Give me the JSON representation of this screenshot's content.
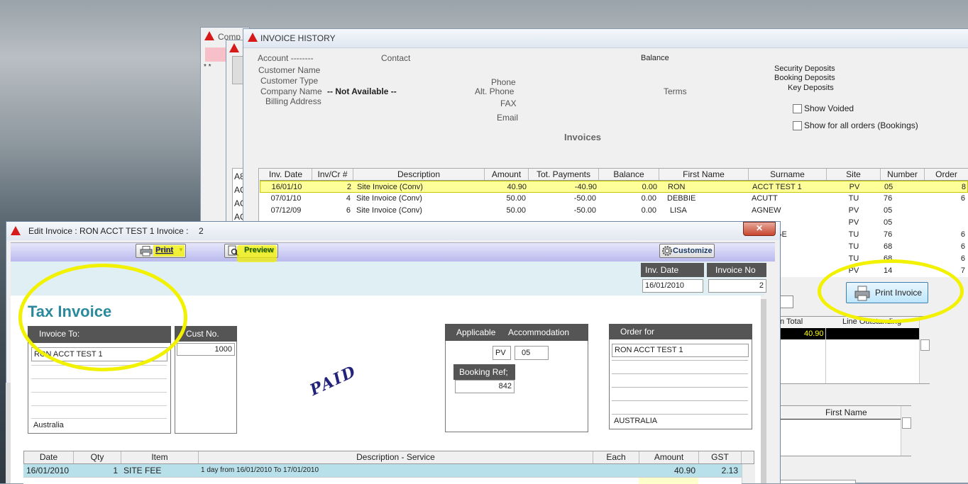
{
  "background_windows": {
    "back1_title": "Comp",
    "stars": "* *",
    "list_items": [
      "A8",
      "AC",
      "AC",
      "AC"
    ]
  },
  "history": {
    "title": "INVOICE HISTORY",
    "account_label": "Account --------",
    "contact_label": "Contact",
    "balance_label": "Balance",
    "customer_name_label": "Customer Name",
    "customer_type_label": "Customer Type",
    "company_name_label": "Company Name",
    "company_name_value": "-- Not Available --",
    "billing_address_label": "Billing Address",
    "phone_label": "Phone",
    "alt_phone_label": "Alt. Phone",
    "fax_label": "FAX",
    "email_label": "Email",
    "terms_label": "Terms",
    "security_deposits": "Security Deposits",
    "booking_deposits": "Booking Deposits",
    "key_deposits": "Key Deposits",
    "show_voided": "Show Voided",
    "show_all_orders": "Show for all orders (Bookings)",
    "invoices_heading": "Invoices",
    "columns": [
      "Inv. Date",
      "Inv/Cr #",
      "Description",
      "Amount",
      "Tot. Payments",
      "Balance",
      "First Name",
      "Surname",
      "Site",
      "Number",
      "Order"
    ],
    "rows": [
      {
        "date": "16/01/10",
        "num": "2",
        "desc": "Site Invoice (Conv)",
        "amount": "40.90",
        "payments": "-40.90",
        "balance": "0.00",
        "first": "RON",
        "surname": "ACCT TEST 1",
        "site": "PV",
        "number": "05",
        "order": "8"
      },
      {
        "date": "07/01/10",
        "num": "4",
        "desc": "Site Invoice (Conv)",
        "amount": "50.00",
        "payments": "-50.00",
        "balance": "0.00",
        "first": "DEBBIE",
        "surname": "ACUTT",
        "site": "TU",
        "number": "76",
        "order": "6"
      },
      {
        "date": "07/12/09",
        "num": "6",
        "desc": "Site Invoice (Conv)",
        "amount": "50.00",
        "payments": "-50.00",
        "balance": "0.00",
        "first": "LISA",
        "surname": "AGNEW",
        "site": "PV",
        "number": "05",
        "order": ""
      },
      {
        "date": "",
        "num": "",
        "desc": "",
        "amount": "",
        "payments": "",
        "balance": "",
        "first": "",
        "surname": "",
        "site": "PV",
        "number": "05",
        "order": ""
      },
      {
        "date": "",
        "num": "",
        "desc": "",
        "amount": "",
        "payments": "",
        "balance": "",
        "first": "",
        "surname": "GE",
        "site": "TU",
        "number": "76",
        "order": "6"
      },
      {
        "date": "",
        "num": "",
        "desc": "",
        "amount": "",
        "payments": "",
        "balance": "",
        "first": "",
        "surname": "",
        "site": "TU",
        "number": "68",
        "order": "6"
      },
      {
        "date": "",
        "num": "",
        "desc": "",
        "amount": "",
        "payments": "",
        "balance": "",
        "first": "",
        "surname": "",
        "site": "TU",
        "number": "68",
        "order": "6"
      },
      {
        "date": "",
        "num": "",
        "desc": "",
        "amount": "",
        "payments": "",
        "balance": "",
        "first": "",
        "surname": "",
        "site": "PV",
        "number": "14",
        "order": "7"
      }
    ],
    "print_invoice": "Print Invoice",
    "line_total_label": "n Total",
    "line_outstanding_label": "Line Outstanding",
    "line_total_value": "40.90",
    "first_name_col": "First Name"
  },
  "edit": {
    "title": "Edit Invoice : RON ACCT TEST 1 Invoice :",
    "title_number": "2",
    "close_glyph": "✕",
    "print_label": "Print",
    "preview_label": "Preview",
    "customize_label": "Customize",
    "inv_date_label": "Inv. Date",
    "inv_date_value": "16/01/2010",
    "invoice_no_label": "Invoice No",
    "invoice_no_value": "2",
    "tax_invoice": "Tax Invoice",
    "invoice_to_label": "Invoice To:",
    "invoice_to_name": "RON ACCT TEST 1",
    "invoice_to_country": "Australia",
    "cust_no_label": "Cust No.",
    "cust_no_value": "1000",
    "paid_stamp": "PAID",
    "applicable_label": "Applicable",
    "accommodation_label": "Accommodation",
    "site_code": "PV",
    "site_number": "05",
    "booking_ref_label": "Booking Ref;",
    "booking_ref_value": "842",
    "order_for_label": "Order for",
    "order_for_name": "RON ACCT TEST 1",
    "order_for_country": "AUSTRALIA",
    "line_columns": [
      "Date",
      "Qty",
      "Item",
      "Description - Service",
      "Each",
      "Amount",
      "GST"
    ],
    "line_row": {
      "date": "16/01/2010",
      "qty": "1",
      "item": "SITE FEE",
      "desc": "1 day from 16/01/2010 To 17/01/2010",
      "each": "",
      "amount": "40.90",
      "gst": "2.13"
    }
  },
  "colors": {
    "highlight": "#f2f200",
    "tax_invoice_teal": "#2a8a9c",
    "selected_row": "#ffff99",
    "toolbar_lavender": "#c9c9f4"
  }
}
